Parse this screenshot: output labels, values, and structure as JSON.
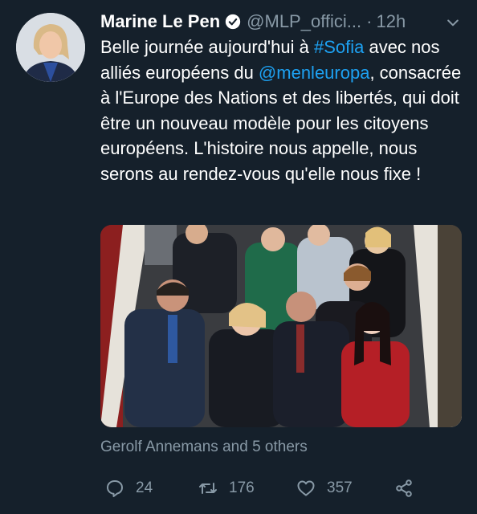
{
  "tweet": {
    "author_name": "Marine Le Pen",
    "handle": "@MLP_offici...",
    "separator": "·",
    "time": "12h",
    "text_segments": [
      "Belle journée aujourd'hui à ",
      "#Sofia",
      " avec nos alliés européens du ",
      "@menleuropa",
      ", consacrée à l'Europe des Nations et des libertés, qui doit être un nouveau modèle pour les citoyens européens. L'histoire nous appelle, nous serons au rendez-vous qu'elle nous fixe !"
    ],
    "tagged": "Gerolf Annemans and 5 others"
  },
  "actions": {
    "replies": "24",
    "retweets": "176",
    "likes": "357"
  },
  "icons": {
    "verified": "verified-badge-icon",
    "menu": "chevron-down-icon",
    "reply": "reply-icon",
    "retweet": "retweet-icon",
    "like": "heart-icon",
    "share": "share-icon"
  },
  "colors": {
    "background": "#15202b",
    "link": "#1da1f2",
    "muted": "#8899a6",
    "text": "#ffffff"
  }
}
